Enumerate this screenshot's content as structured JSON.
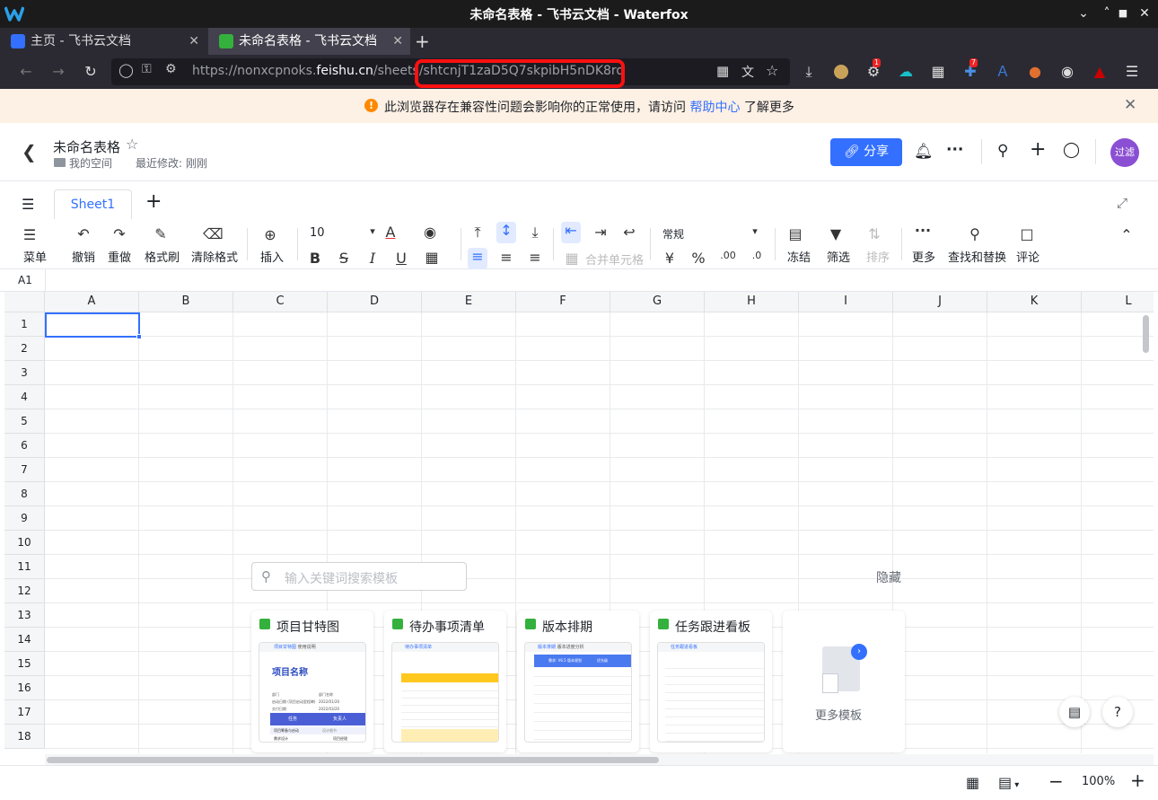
{
  "window": {
    "title": "未命名表格 - 飞书云文档 - Waterfox",
    "minimize": "⌄",
    "restore": "˄",
    "maximize": "■",
    "close": "✕"
  },
  "tabs": [
    {
      "label": "主页 - 飞书云文档",
      "close": "✕"
    },
    {
      "label": "未命名表格 - 飞书云文档",
      "close": "✕"
    }
  ],
  "new_tab": "+",
  "url": {
    "prefix": "https://nonxcpnoks.",
    "domain": "feishu.cn",
    "path": "/sheets/",
    "token": "shtcnjT1zaD5Q7skpibH5nDK8rd"
  },
  "ext_badges": {
    "ext1": "1",
    "ext2": "7"
  },
  "banner": {
    "text": "此浏览器存在兼容性问题会影响你的正常使用，请访问",
    "link": "帮助中心",
    "after": "了解更多",
    "warn": "!",
    "close": "✕"
  },
  "doc": {
    "title": "未命名表格",
    "space": "我的空间",
    "modified": "最近修改: 刚刚",
    "share": "分享",
    "avatar": "过滤"
  },
  "sheet_tab": "Sheet1",
  "toolbar": {
    "menu": "菜单",
    "undo": "撤销",
    "redo": "重做",
    "format_painter": "格式刷",
    "clear_format": "清除格式",
    "insert": "插入",
    "font_size": "10",
    "merge": "合并单元格",
    "number_format": "常规",
    "freeze": "冻结",
    "filter": "筛选",
    "sort": "排序",
    "more": "更多",
    "find_replace": "查找和替换",
    "comment": "评论"
  },
  "cell_ref": "A1",
  "columns": [
    "A",
    "B",
    "C",
    "D",
    "E",
    "F",
    "G",
    "H",
    "I",
    "J",
    "K",
    "L"
  ],
  "rows": [
    "1",
    "2",
    "3",
    "4",
    "5",
    "6",
    "7",
    "8",
    "9",
    "10",
    "11",
    "12",
    "13",
    "14",
    "15",
    "16",
    "17",
    "18"
  ],
  "templates": {
    "search_placeholder": "输入关键词搜索模板",
    "hide": "隐藏",
    "items": [
      {
        "name": "项目甘特图",
        "thumb_title": "项目名称",
        "thumb_tabs": [
          "项目甘特图",
          "使用说明"
        ],
        "thumb_labels": [
          "部门",
          "部门名称",
          "启动日期 (项目启动里程碑)",
          "2022/01/20",
          "交付日期",
          "2022/03/20",
          "任务",
          "负责人",
          "项目筹备与启动",
          "需求设计",
          "设计细节",
          "项目经理"
        ]
      },
      {
        "name": "待办事项清单",
        "thumb_tabs": [
          "待办事项清单"
        ]
      },
      {
        "name": "版本排期",
        "thumb_tabs": [
          "版本排期",
          "版本进度分析"
        ],
        "thumb_labels": [
          "需求: V6.5 版本规划",
          "优先级"
        ]
      },
      {
        "name": "任务跟进看板",
        "thumb_tabs": [
          "任务跟进看板"
        ]
      }
    ],
    "more": "更多模板"
  },
  "status": {
    "zoom": "100%"
  }
}
